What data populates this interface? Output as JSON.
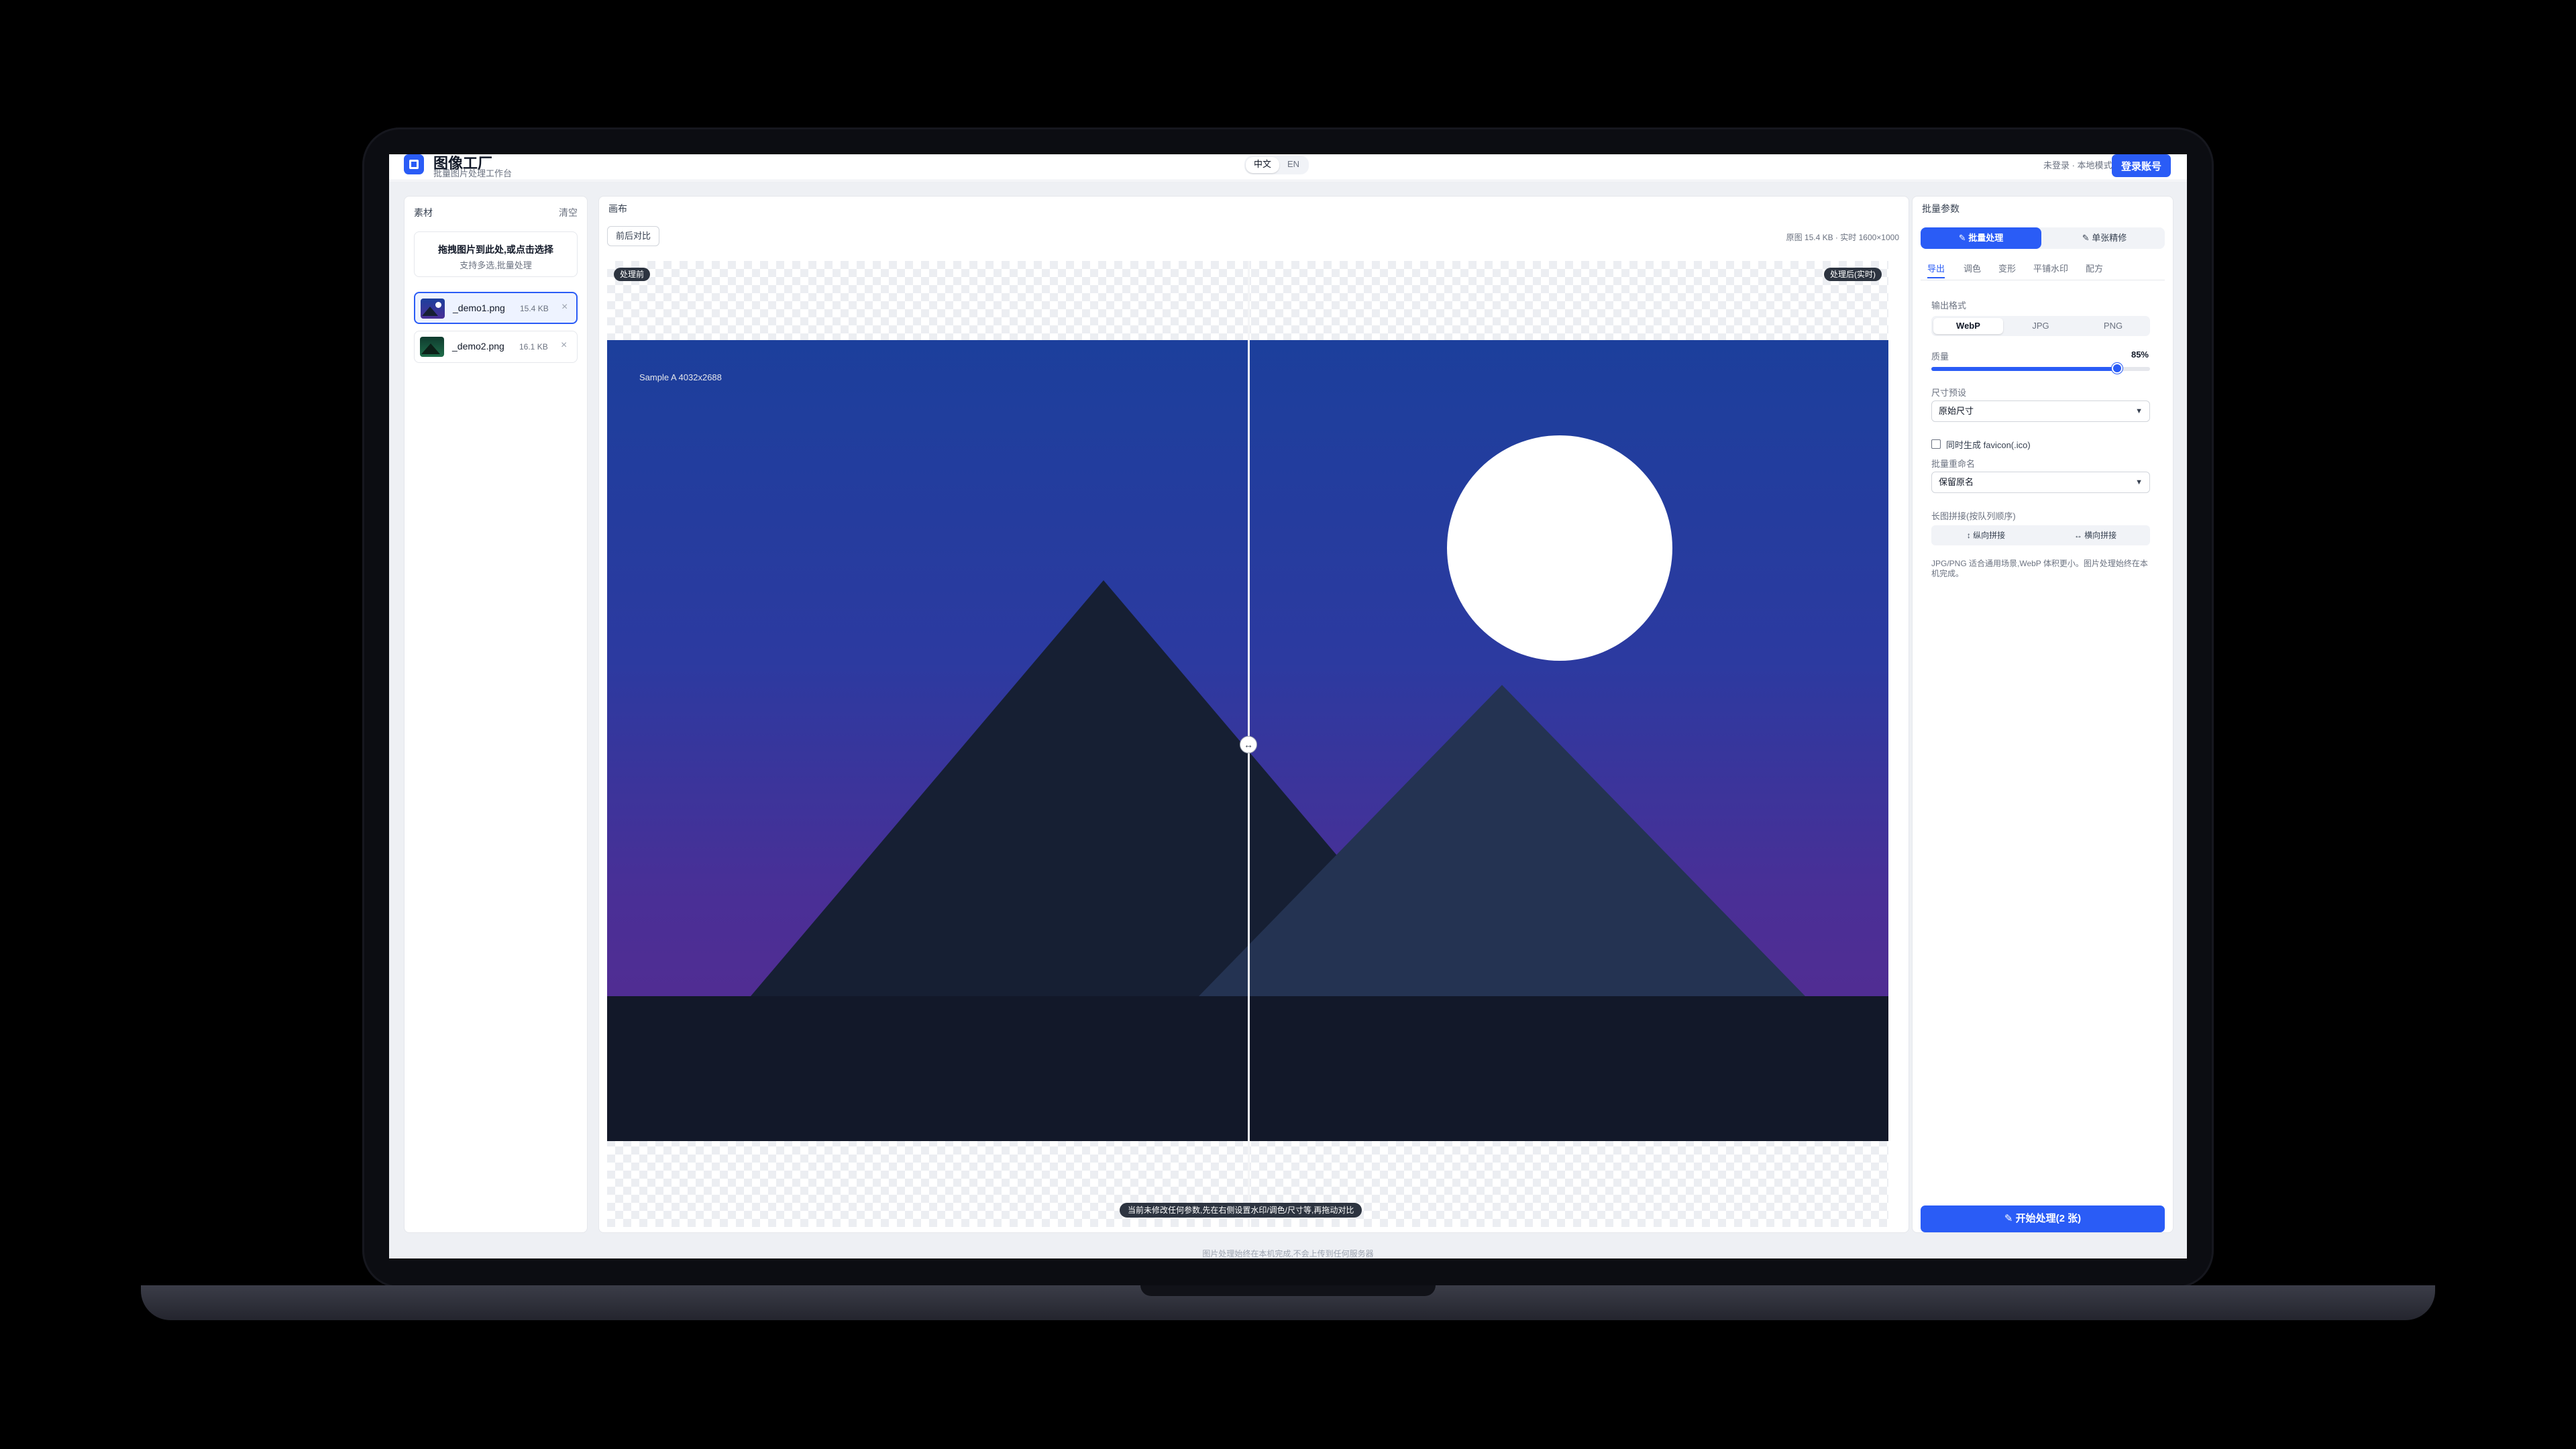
{
  "header": {
    "app_title": "图像工厂",
    "app_subtitle": "批量图片处理工作台",
    "lang_options": [
      "中文",
      "EN"
    ],
    "lang_selected": "中文",
    "status_text": "未登录 · 本地模式",
    "login_label": "登录账号"
  },
  "left_panel": {
    "title": "素材",
    "clear_label": "清空",
    "drop_title": "拖拽图片到此处,或点击选择",
    "drop_subtitle": "支持多选,批量处理",
    "files": [
      {
        "name": "_demo1.png",
        "size": "15.4 KB",
        "selected": true,
        "icon": "image-thumbnail-icon"
      },
      {
        "name": "_demo2.png",
        "size": "16.1 KB",
        "selected": false,
        "icon": "image-thumbnail-icon"
      }
    ],
    "remove_glyph": "×"
  },
  "canvas_panel": {
    "title": "画布",
    "compare_label": "前后对比",
    "meta_text": "原图 15.4 KB · 实时 1600×1000",
    "before_tag": "处理前",
    "after_tag": "处理后(实时)",
    "image_caption": "Sample A 4032x2688",
    "hint_text": "当前未修改任何参数,先在右侧设置水印/调色/尺寸等,再拖动对比",
    "compare_position": 0.5,
    "handle_icon": "compare-handle-icon",
    "colors": {
      "sky_top": "#1c3f9c",
      "sky_bottom": "#5a2a8e",
      "moon": "#ffffff",
      "ground": "#121829"
    }
  },
  "right_panel": {
    "title": "批量参数",
    "mode_batch": "✎ 批量处理",
    "mode_single": "✎ 单张精修",
    "tabs": [
      "导出",
      "调色",
      "变形",
      "平铺水印",
      "配方"
    ],
    "active_tab": "导出",
    "format_label": "输出格式",
    "formats": [
      "WebP",
      "JPG",
      "PNG"
    ],
    "format_selected": "WebP",
    "quality_label": "质量",
    "quality_value": "85%",
    "quality_fraction": 0.85,
    "size_label": "尺寸预设",
    "size_value": "原始尺寸",
    "favicon_label": "同时生成 favicon(.ico)",
    "favicon_checked": false,
    "rename_label": "批量重命名",
    "rename_value": "保留原名",
    "merge_label": "长图拼接(按队列顺序)",
    "merge_vertical": "↕ 纵向拼接",
    "merge_horizontal": "↔ 横向拼接",
    "note_text": "JPG/PNG 适合通用场景,WebP 体积更小。图片处理始终在本机完成。",
    "start_label": "✎ 开始处理(2 张)",
    "accent": "#2a5cf6"
  },
  "footer": {
    "text": "图片处理始终在本机完成,不会上传到任何服务器"
  }
}
